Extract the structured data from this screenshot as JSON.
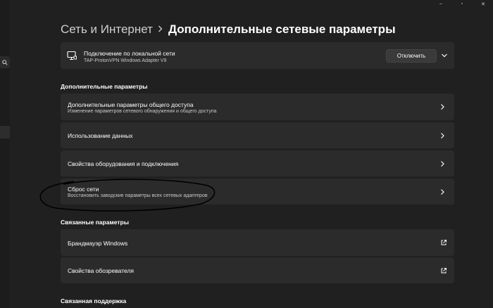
{
  "window": {
    "minimize": "–",
    "maximize": "▫",
    "close": "✕"
  },
  "breadcrumb": {
    "parent": "Сеть и Интернет",
    "separator": "›",
    "current": "Дополнительные сетевые параметры"
  },
  "connection": {
    "title": "Подключение по локальной сети",
    "subtitle": "TAP-ProtonVPN Windows Adapter V9",
    "disconnect_label": "Отключить"
  },
  "advanced_section": {
    "title": "Дополнительные параметры",
    "items": [
      {
        "title": "Дополнительные параметры общего доступа",
        "subtitle": "Изменение параметров сетевого обнаружения и общего доступа"
      },
      {
        "title": "Использование данных"
      },
      {
        "title": "Свойства оборудования и подключения"
      },
      {
        "title": "Сброс сети",
        "subtitle": "Восстановить заводские параметры всех сетевых адаптеров"
      }
    ]
  },
  "related_section": {
    "title": "Связанные параметры",
    "items": [
      {
        "title": "Брандмауэр Windows"
      },
      {
        "title": "Свойства обозревателя"
      }
    ]
  },
  "support_section": {
    "title": "Связанная поддержка"
  },
  "colors": {
    "background": "#202020",
    "card": "#2b2b2b",
    "text": "#ffffff",
    "subtext": "#c8c8c8"
  }
}
